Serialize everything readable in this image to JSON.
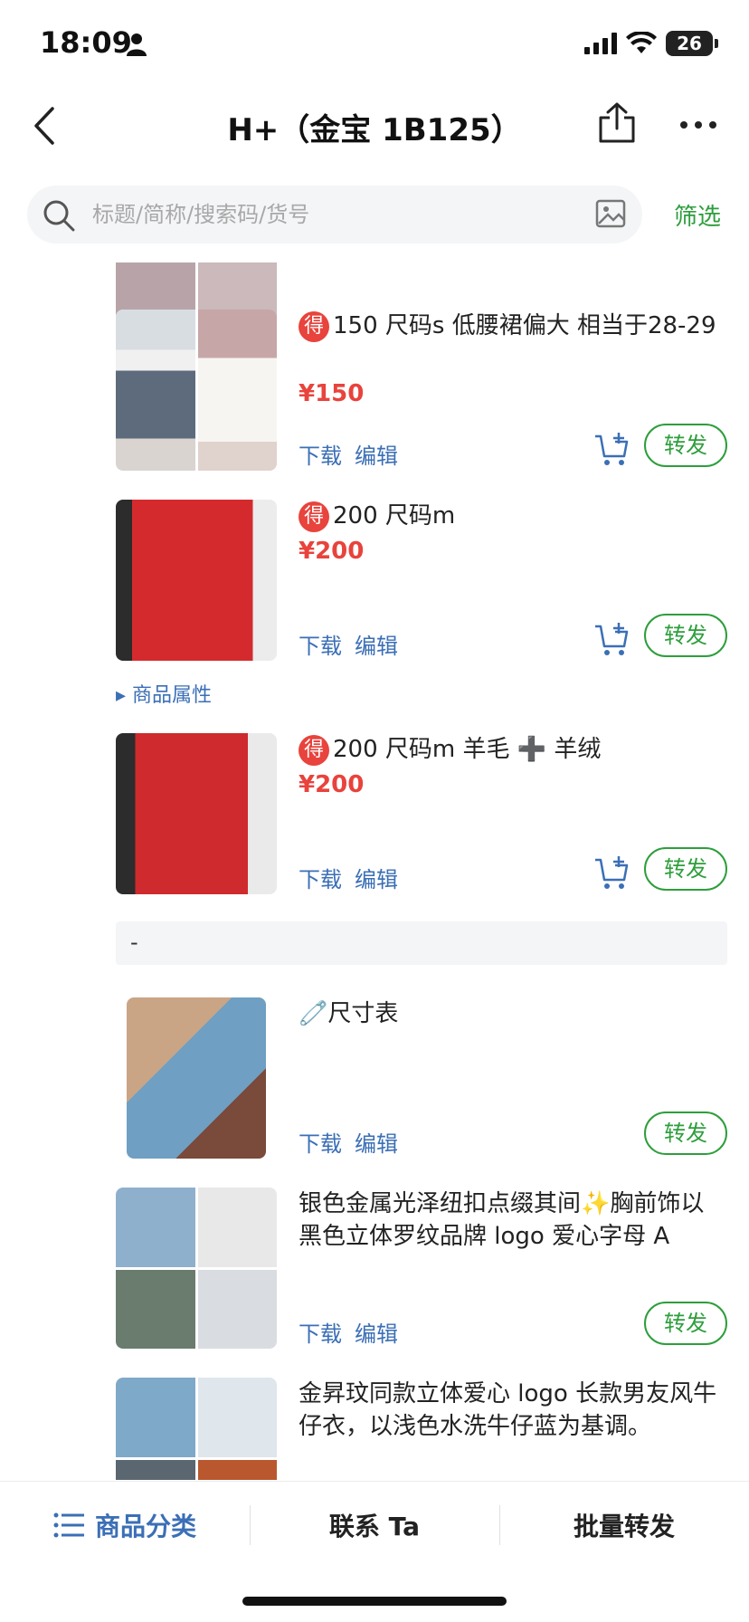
{
  "status": {
    "time": "18:09",
    "battery": "26"
  },
  "nav": {
    "title": "H+（金宝 1B125）"
  },
  "search": {
    "placeholder": "标题/简称/搜索码/货号",
    "filter_label": "筛选"
  },
  "actions": {
    "download": "下载",
    "edit": "编辑",
    "forward": "转发"
  },
  "badge": "得",
  "colors": {
    "accent_green": "#2e9e3c",
    "price_red": "#e8433c",
    "link_blue": "#3b6fb6"
  },
  "items": [
    {
      "title": "150 尺码s 低腰裙偏大 相当于28-29",
      "price": "¥150"
    },
    {
      "title": "200 尺码m",
      "price": "¥200"
    },
    {
      "title": "200 尺码m 羊毛 ➕ 羊绒",
      "price": "¥200"
    },
    {
      "title": "🧷尺寸表"
    },
    {
      "title": "银色金属光泽纽扣点缀其间✨胸前饰以黑色立体罗纹品牌 logo 爱心字母 A"
    },
    {
      "title": "金昇玟同款立体爱心 logo 长款男友风牛仔衣，以浅色水洗牛仔蓝为基调。"
    }
  ],
  "attributes_label": "商品属性",
  "separator_text": "-",
  "bottom_bar": {
    "categories": "商品分类",
    "contact": "联系 Ta",
    "batch_forward": "批量转发"
  }
}
